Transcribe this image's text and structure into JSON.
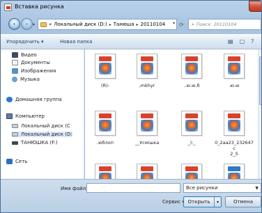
{
  "window": {
    "title": "Вставка рисунка"
  },
  "address": {
    "crumbs": [
      "«",
      "Локальный диск (D:)",
      "Танюша",
      "20110104"
    ],
    "search_placeholder": "Поиск: 20110104"
  },
  "toolbar": {
    "organize": "Упорядочить ▾",
    "new_folder": "Новая папка"
  },
  "sidebar": {
    "libraries": [
      "Видео",
      "Документы",
      "Изображения",
      "Музыка"
    ],
    "homegroup": "Домашняя группа",
    "computer": "Компьютер",
    "drives": [
      "Локальный диск (C",
      "Локальный диск (D:",
      "ТАНЮШКА (F:)"
    ],
    "network": "Сеть"
  },
  "files": {
    "items": [
      {
        "name": "(R)-"
      },
      {
        "name": ",mkhyr"
      },
      {
        "name": "..ю.ю.б"
      },
      {
        "name": ".ю.ю"
      },
      {
        "name": ".юблоп"
      },
      {
        "name": "__Усмішка"
      },
      {
        "name": "_);_"
      },
      {
        "name": "0_2aa23_232647c\n2_S"
      },
      {
        "name": ""
      },
      {
        "name": ""
      },
      {
        "name": ""
      },
      {
        "name": ""
      }
    ]
  },
  "bottom": {
    "filename_label": "Имя файла:",
    "filename_value": "",
    "type_value": "Все рисунки",
    "service_label": "Сервис",
    "open_label": "Открыть",
    "cancel_label": "Отмена"
  }
}
